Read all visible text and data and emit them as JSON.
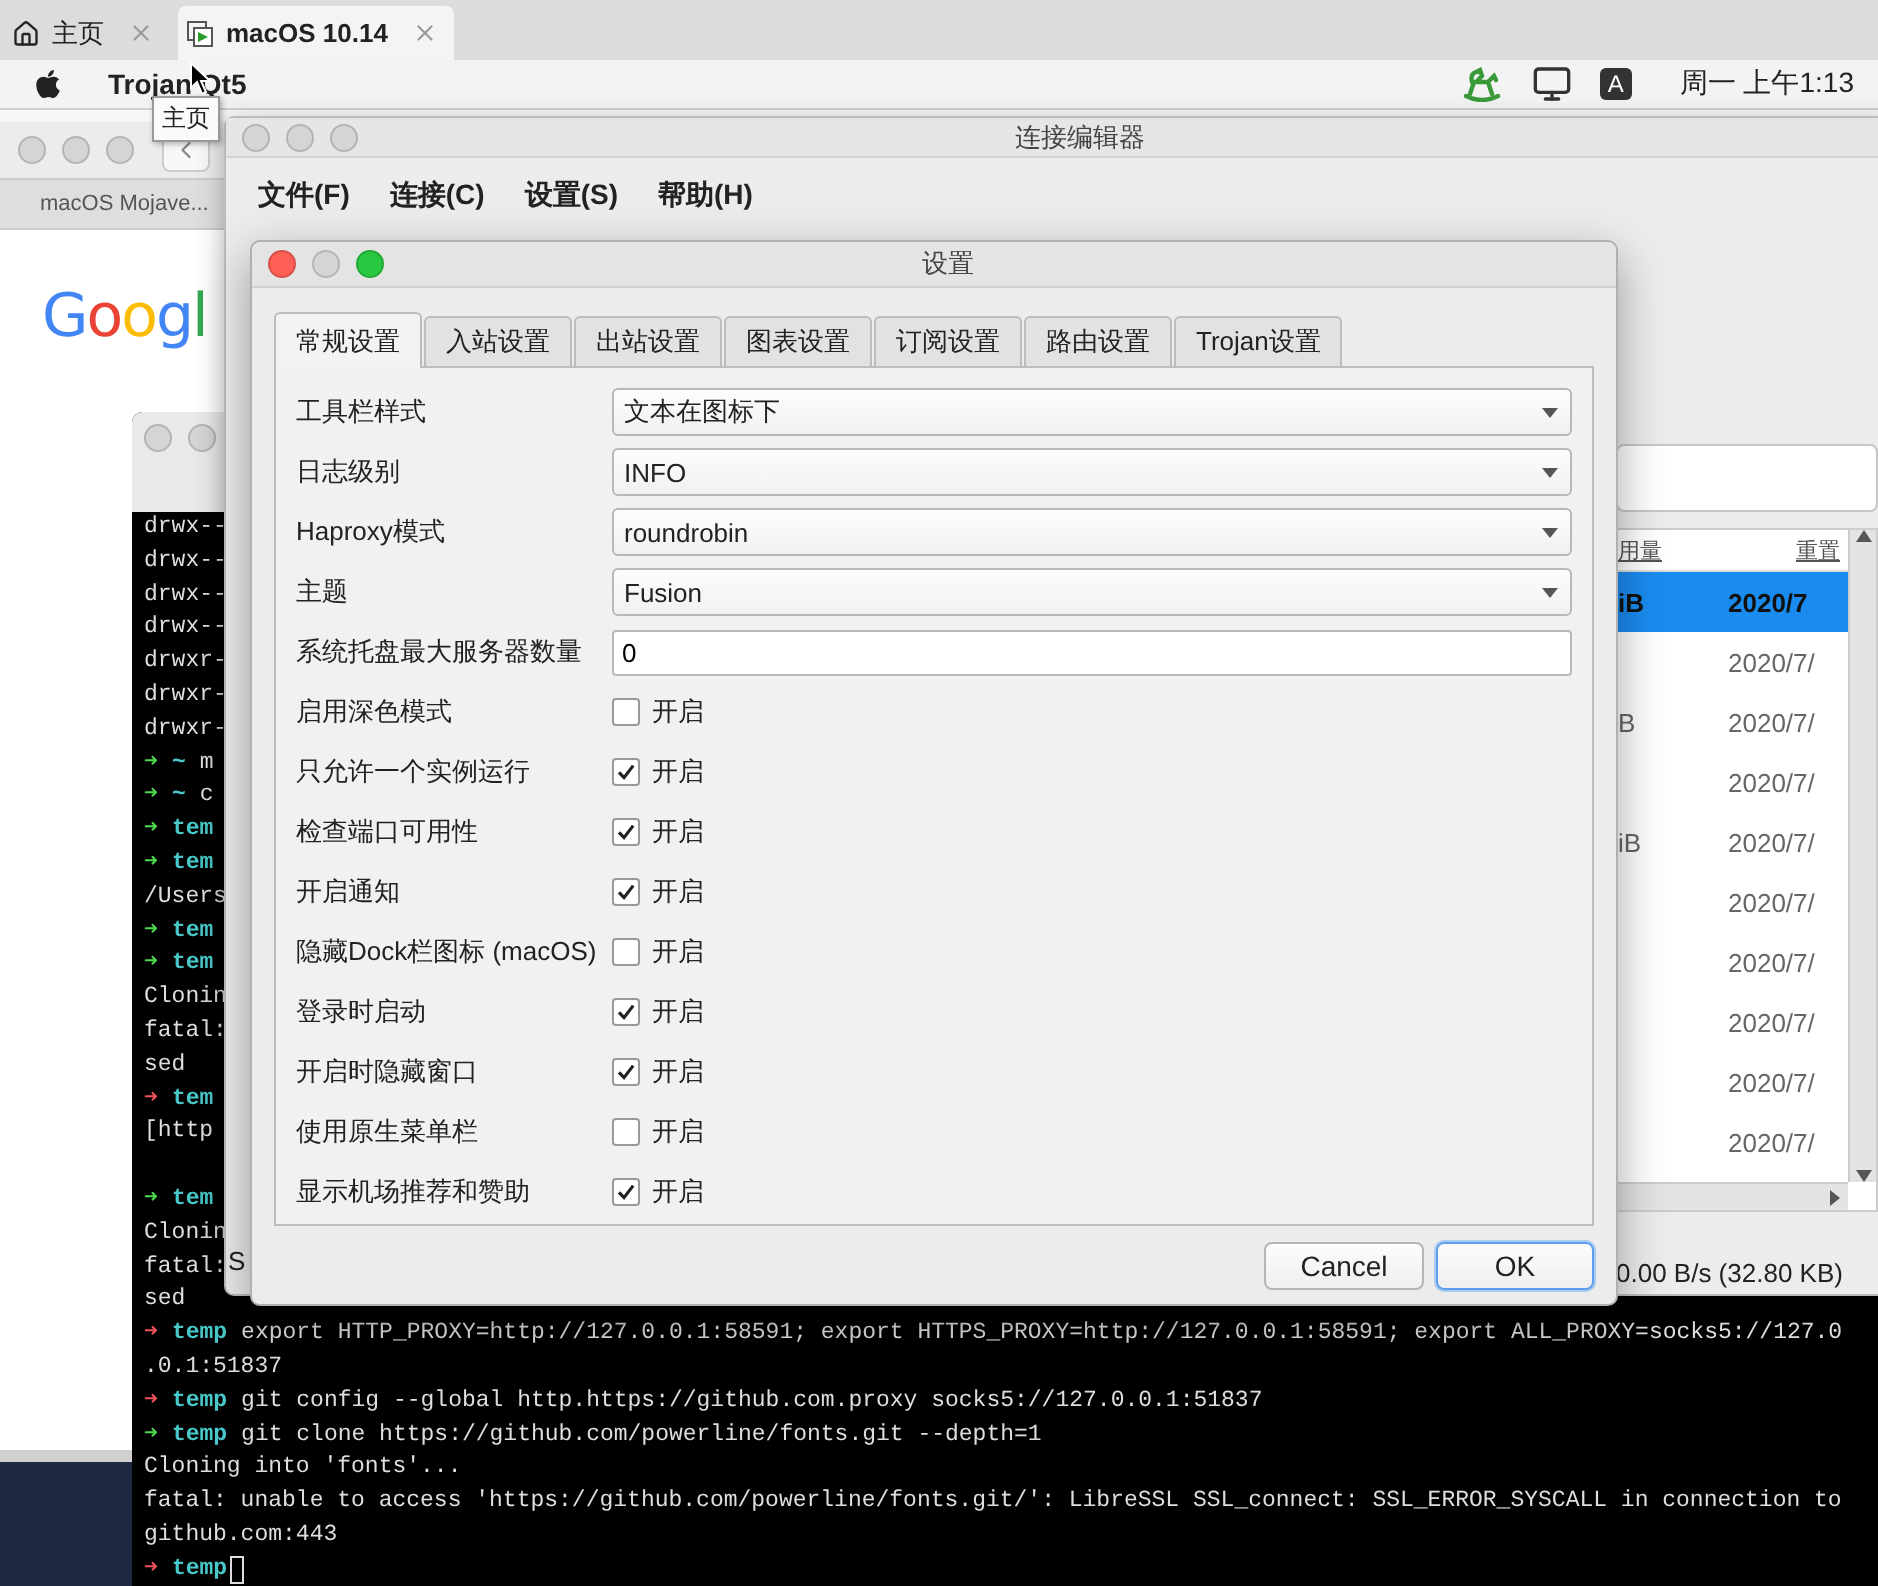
{
  "browser_tabs": [
    {
      "kind": "home",
      "label": "主页",
      "selected": false
    },
    {
      "kind": "vm",
      "label": "macOS 10.14",
      "selected": true
    }
  ],
  "tooltip": "主页",
  "menu_bar": {
    "app_name": "Trojan Qt5",
    "input_method": "A",
    "clock": "周一 上午1:13"
  },
  "back_browser": {
    "tab": "macOS Mojave...",
    "logo": "Googl"
  },
  "terminal": {
    "lines": [
      {
        "kind": "output",
        "text": "drwx--"
      },
      {
        "kind": "output",
        "text": "drwx--"
      },
      {
        "kind": "output",
        "text": "drwx--"
      },
      {
        "kind": "output",
        "text": "drwx--"
      },
      {
        "kind": "output",
        "text": "drwxr-"
      },
      {
        "kind": "output",
        "text": "drwxr-"
      },
      {
        "kind": "output",
        "text": "drwxr-"
      },
      {
        "kind": "prompt",
        "failed": false,
        "arrow": "➜",
        "dir": "~",
        "command": "m"
      },
      {
        "kind": "prompt",
        "failed": false,
        "arrow": "➜",
        "dir": "~",
        "command": "c"
      },
      {
        "kind": "prompt",
        "failed": false,
        "arrow": "➜",
        "dir": "tem"
      },
      {
        "kind": "prompt",
        "failed": false,
        "arrow": "➜",
        "dir": "tem"
      },
      {
        "kind": "output",
        "text": "/Users"
      },
      {
        "kind": "prompt",
        "failed": false,
        "arrow": "➜",
        "dir": "tem"
      },
      {
        "kind": "prompt",
        "failed": false,
        "arrow": "➜",
        "dir": "tem"
      },
      {
        "kind": "output",
        "text": "Clonin"
      },
      {
        "kind": "output",
        "text": "fatal:"
      },
      {
        "kind": "output",
        "text": "sed"
      },
      {
        "kind": "prompt",
        "failed": true,
        "arrow": "➜",
        "dir": "tem"
      },
      {
        "kind": "output",
        "text": "[http"
      },
      {
        "kind": "blank"
      },
      {
        "kind": "prompt",
        "failed": false,
        "arrow": "➜",
        "dir": "tem"
      },
      {
        "kind": "output",
        "text": "Clonin"
      },
      {
        "kind": "output",
        "text": "fatal:"
      },
      {
        "kind": "output",
        "text": "sed"
      },
      {
        "kind": "prompt",
        "failed": true,
        "arrow": "➜",
        "dir": "temp",
        "command": "export HTTP_PROXY=http://127.0.0.1:58591; export HTTPS_PROXY=http://127.0.0.1:58591; export ALL_PROXY=socks5://127.0"
      },
      {
        "kind": "output",
        "text": ".0.1:51837"
      },
      {
        "kind": "prompt",
        "failed": true,
        "arrow": "➜",
        "dir": "temp",
        "command": "git config --global http.https://github.com.proxy socks5://127.0.0.1:51837"
      },
      {
        "kind": "prompt",
        "failed": false,
        "arrow": "➜",
        "dir": "temp",
        "command": "git clone https://github.com/powerline/fonts.git --depth=1"
      },
      {
        "kind": "output",
        "text": "Cloning into 'fonts'..."
      },
      {
        "kind": "output",
        "text": "fatal: unable to access 'https://github.com/powerline/fonts.git/': LibreSSL SSL_connect: SSL_ERROR_SYSCALL in connection to"
      },
      {
        "kind": "output",
        "text": "github.com:443"
      },
      {
        "kind": "prompt",
        "failed": true,
        "arrow": "➜",
        "dir": "temp",
        "cursor": true
      }
    ]
  },
  "connection_editor": {
    "title": "连接编辑器",
    "menus": [
      "文件(F)",
      "连接(C)",
      "设置(S)",
      "帮助(H)"
    ],
    "table": {
      "columns": [
        "用量",
        "重置"
      ],
      "rows": [
        {
          "selected": true,
          "col_1": "iB",
          "col_2": "2020/7"
        },
        {
          "selected": false,
          "col_2": "2020/7/"
        },
        {
          "selected": false,
          "col_1": "B",
          "col_2": "2020/7/"
        },
        {
          "selected": false,
          "col_2": "2020/7/"
        },
        {
          "selected": false,
          "col_1": "iB",
          "col_2": "2020/7/"
        },
        {
          "selected": false,
          "col_2": "2020/7/"
        },
        {
          "selected": false,
          "col_2": "2020/7/"
        },
        {
          "selected": false,
          "col_2": "2020/7/"
        },
        {
          "selected": false,
          "col_2": "2020/7/"
        },
        {
          "selected": false,
          "col_2": "2020/7/"
        }
      ]
    },
    "status_left": "S",
    "status_right": "0.00 B/s (32.80 KB)"
  },
  "settings": {
    "title": "设置",
    "tabs": [
      {
        "label": "常规设置",
        "selected": true
      },
      {
        "label": "入站设置",
        "selected": false
      },
      {
        "label": "出站设置",
        "selected": false
      },
      {
        "label": "图表设置",
        "selected": false
      },
      {
        "label": "订阅设置",
        "selected": false
      },
      {
        "label": "路由设置",
        "selected": false
      },
      {
        "label": "Trojan设置",
        "selected": false
      }
    ],
    "fields": [
      {
        "kind": "select",
        "label": "工具栏样式",
        "value": "文本在图标下"
      },
      {
        "kind": "select",
        "label": "日志级别",
        "value": "INFO"
      },
      {
        "kind": "select",
        "label": "Haproxy模式",
        "value": "roundrobin"
      },
      {
        "kind": "select",
        "label": "主题",
        "value": "Fusion"
      },
      {
        "kind": "number",
        "label": "系统托盘最大服务器数量",
        "value": "0"
      },
      {
        "kind": "checkbox",
        "label": "启用深色模式",
        "text": "开启",
        "checked": false
      },
      {
        "kind": "checkbox",
        "label": "只允许一个实例运行",
        "text": "开启",
        "checked": true
      },
      {
        "kind": "checkbox",
        "label": "检查端口可用性",
        "text": "开启",
        "checked": true
      },
      {
        "kind": "checkbox",
        "label": "开启通知",
        "text": "开启",
        "checked": true
      },
      {
        "kind": "checkbox",
        "label": "隐藏Dock栏图标 (macOS)",
        "text": "开启",
        "checked": false
      },
      {
        "kind": "checkbox",
        "label": "登录时启动",
        "text": "开启",
        "checked": true
      },
      {
        "kind": "checkbox",
        "label": "开启时隐藏窗口",
        "text": "开启",
        "checked": true
      },
      {
        "kind": "checkbox",
        "label": "使用原生菜单栏",
        "text": "开启",
        "checked": false
      },
      {
        "kind": "checkbox",
        "label": "显示机场推荐和赞助",
        "text": "开启",
        "checked": true
      }
    ],
    "buttons": [
      {
        "label": "Cancel",
        "default": false
      },
      {
        "label": "OK",
        "default": true
      }
    ]
  }
}
